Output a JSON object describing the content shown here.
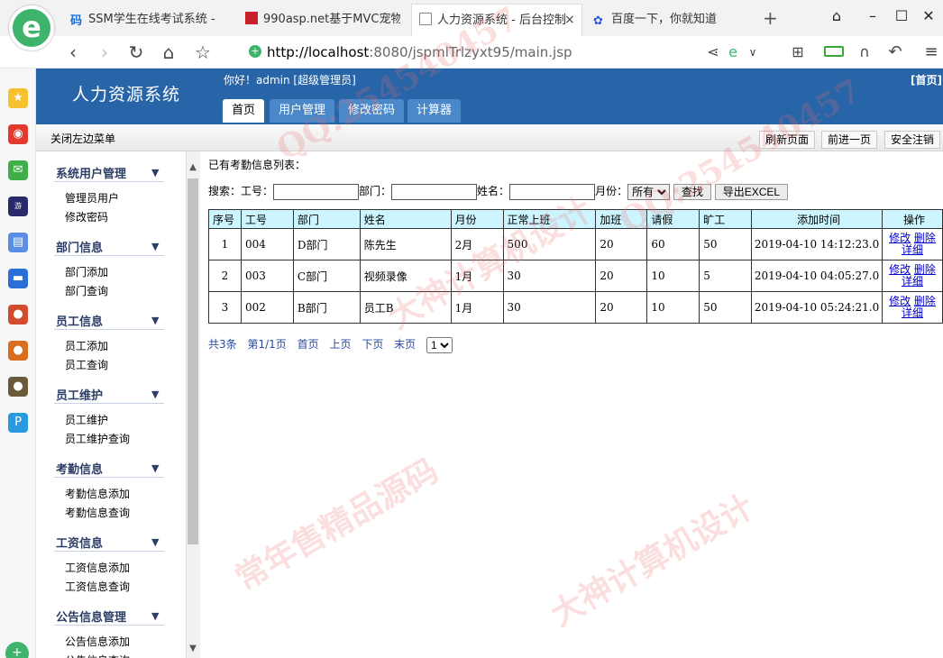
{
  "browser": {
    "tabs": [
      {
        "icon_label": "码",
        "label": "SSM学生在线考试系统 -"
      },
      {
        "label": "990asp.net基于MVC宠物"
      },
      {
        "label": "人力资源系统 - 后台控制"
      },
      {
        "label": "百度一下，你就知道"
      }
    ],
    "close_tab": "×",
    "new_tab": "+",
    "url_host": "http://localhost",
    "url_rest": ":8080/jspmlTrlzyxt95/main.jsp"
  },
  "sidebar_apps": [
    "star",
    "weibo",
    "mail",
    "game",
    "docs",
    "chat",
    "game2",
    "game3",
    "game4",
    "pay"
  ],
  "header": {
    "app_title": "人力资源系统",
    "greeting": "你好！admin [超级管理员]",
    "home_link": "[首页]",
    "tabs": [
      "首页",
      "用户管理",
      "修改密码",
      "计算器"
    ]
  },
  "toolbar": {
    "close_left_menu": "关闭左边菜单",
    "refresh": "刷新页面",
    "forward": "前进一页",
    "logout": "安全注销"
  },
  "menu": [
    {
      "title": "系统用户管理",
      "items": [
        "管理员用户",
        "修改密码"
      ]
    },
    {
      "title": "部门信息",
      "items": [
        "部门添加",
        "部门查询"
      ]
    },
    {
      "title": "员工信息",
      "items": [
        "员工添加",
        "员工查询"
      ]
    },
    {
      "title": "员工维护",
      "items": [
        "员工维护",
        "员工维护查询"
      ]
    },
    {
      "title": "考勤信息",
      "items": [
        "考勤信息添加",
        "考勤信息查询"
      ]
    },
    {
      "title": "工资信息",
      "items": [
        "工资信息添加",
        "工资信息查询"
      ]
    },
    {
      "title": "公告信息管理",
      "items": [
        "公告信息添加",
        "公告信息查询"
      ]
    }
  ],
  "menu_arrow": "▼",
  "content": {
    "list_title": "已有考勤信息列表：",
    "search": {
      "label_search": "搜索：",
      "label_id": "工号：",
      "label_dept": "部门：",
      "label_name": "姓名：",
      "label_month": "月份：",
      "month_selected": "所有",
      "search_button": "查找",
      "export_button": "导出EXCEL"
    },
    "table": {
      "headers": [
        "序号",
        "工号",
        "部门",
        "姓名",
        "月份",
        "正常上班",
        "加班",
        "请假",
        "旷工",
        "添加时间",
        "操作"
      ],
      "rows": [
        {
          "no": "1",
          "id": "004",
          "dept": "D部门",
          "name": "陈先生",
          "month": "2月",
          "normal": "500",
          "overtime": "20",
          "leave": "60",
          "absent": "50",
          "time": "2019-04-10 14:12:23.0"
        },
        {
          "no": "2",
          "id": "003",
          "dept": "C部门",
          "name": "视频录像",
          "month": "1月",
          "normal": "30",
          "overtime": "20",
          "leave": "10",
          "absent": "5",
          "time": "2019-04-10 04:05:27.0"
        },
        {
          "no": "3",
          "id": "002",
          "dept": "B部门",
          "name": "员工B",
          "month": "1月",
          "normal": "30",
          "overtime": "20",
          "leave": "10",
          "absent": "50",
          "time": "2019-04-10 05:24:21.0"
        }
      ],
      "op_edit": "修改",
      "op_delete": "删除",
      "op_detail": "详细"
    },
    "pager": {
      "total": "共3条",
      "page_of": "第1/1页",
      "first": "首页",
      "prev": "上页",
      "next": "下页",
      "last": "末页",
      "page_selected": "1"
    }
  },
  "watermarks": [
    "QQ:254540457",
    "大神计算机设计",
    "常年售精品源码"
  ]
}
